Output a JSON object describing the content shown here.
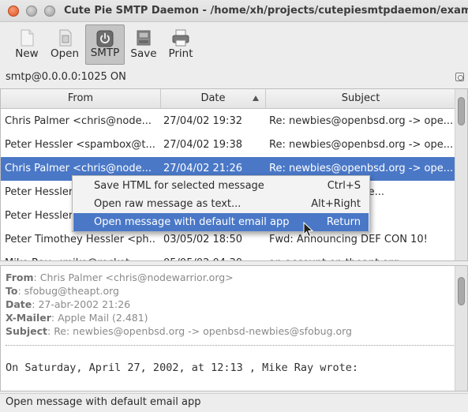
{
  "window": {
    "title": "Cute Pie SMTP Daemon - /home/xh/projects/cutepiesmtpdaemon/examples/s"
  },
  "toolbar": {
    "new_label": "New",
    "open_label": "Open",
    "smtp_label": "SMTP",
    "save_label": "Save",
    "print_label": "Print"
  },
  "server": {
    "status": "smtp@0.0.0.0:1025 ON"
  },
  "list": {
    "columns": [
      "From",
      "Date",
      "Subject"
    ],
    "rows": [
      {
        "from": "Chris Palmer <chris@node...",
        "date": "27/04/02 19:32",
        "subject": "Re: newbies@openbsd.org -> ope..."
      },
      {
        "from": "Peter Hessler <spambox@t...",
        "date": "27/04/02 19:38",
        "subject": "Re: newbies@openbsd.org -> ope..."
      },
      {
        "from": "Chris Palmer <chris@node...",
        "date": "27/04/02 21:26",
        "subject": "Re: newbies@openbsd.org -> ope..."
      },
      {
        "from": "Peter Hessler",
        "date": "",
        "subject": "...penbsd.org -> ope..."
      },
      {
        "from": "Peter Hessler",
        "date": "",
        "subject": ""
      },
      {
        "from": "Peter Timothey Hessler <ph...",
        "date": "03/05/02 18:50",
        "subject": "Fwd: Announcing DEF CON 10!"
      },
      {
        "from": "Mike Ray <mike@rocket...",
        "date": "05/05/02 04:30",
        "subject": "an account on theapt.org"
      }
    ]
  },
  "context_menu": {
    "items": [
      {
        "label": "Save HTML for selected message",
        "shortcut": "Ctrl+S"
      },
      {
        "label": "Open raw message as text...",
        "shortcut": "Alt+Right"
      },
      {
        "label": "Open message with default email app",
        "shortcut": "Return"
      }
    ]
  },
  "preview": {
    "from_label": "From",
    "from_value": "Chris Palmer <chris@nodewarrior.org>",
    "to_label": "To",
    "to_value": "sfobug@theapt.org",
    "date_label": "Date",
    "date_value": "27-abr-2002 21:26",
    "mailer_label": "X-Mailer",
    "mailer_value": "Apple Mail (2.481)",
    "subject_label": "Subject",
    "subject_value": "Re: newbies@openbsd.org -> openbsd-newbies@sfobug.org",
    "body": "On Saturday, April 27, 2002, at 12:13 , Mike Ray wrote:"
  },
  "statusbar": {
    "text": "Open message with default email app"
  },
  "colors": {
    "selection": "#4a78c7",
    "close_button": "#e2541f"
  },
  "icons": [
    "new-document-icon",
    "open-icon",
    "power-icon",
    "save-drive-icon",
    "printer-icon",
    "sort-ascending-icon",
    "mouse-pointer-icon"
  ]
}
